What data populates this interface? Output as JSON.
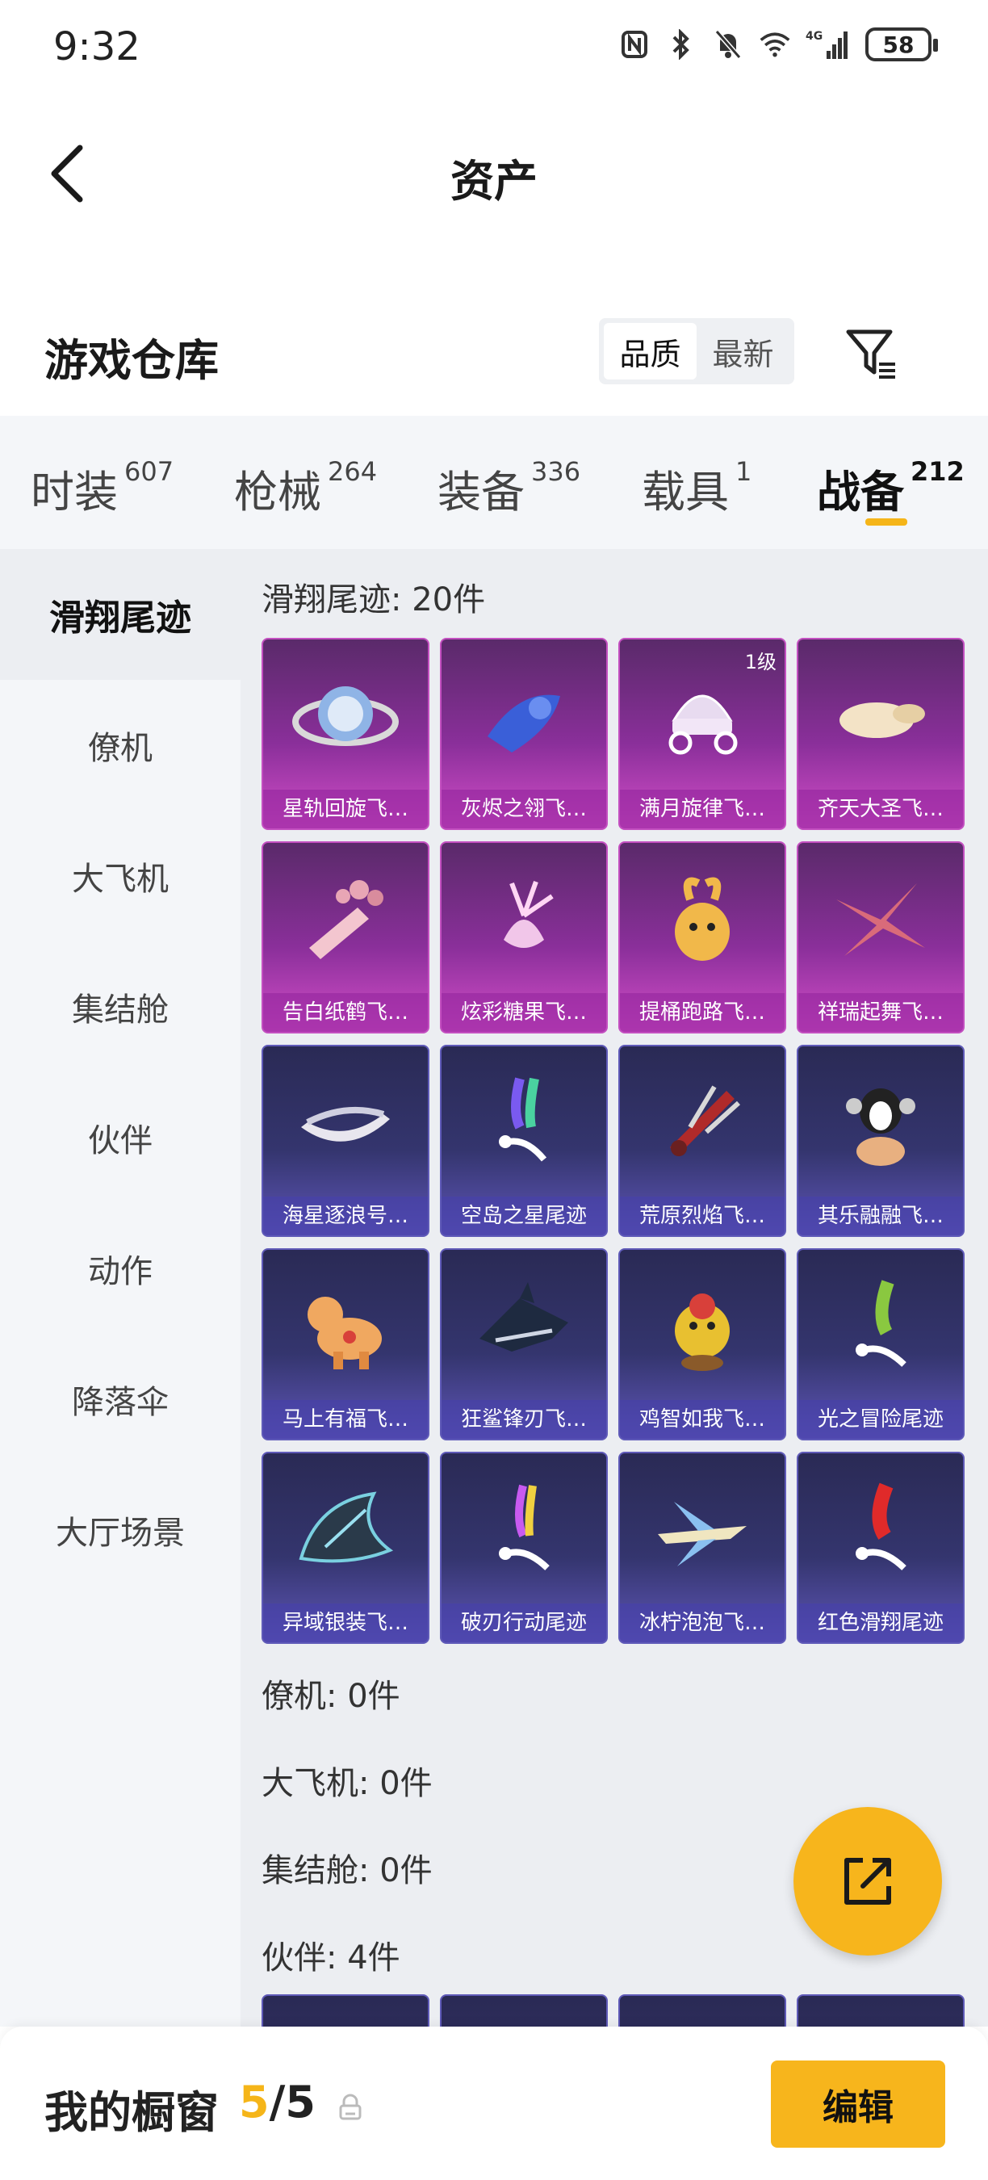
{
  "status_bar": {
    "time": "9:32",
    "network": "4G",
    "battery": "58"
  },
  "header": {
    "title": "资产"
  },
  "warehouse": {
    "title": "游戏仓库",
    "sort_options": [
      "品质",
      "最新"
    ],
    "sort_active": "品质"
  },
  "category_tabs": [
    {
      "label": "时装",
      "count": "607"
    },
    {
      "label": "枪械",
      "count": "264"
    },
    {
      "label": "装备",
      "count": "336"
    },
    {
      "label": "载具",
      "count": "1"
    },
    {
      "label": "战备",
      "count": "212",
      "active": true
    }
  ],
  "side_nav": [
    {
      "label": "滑翔尾迹",
      "active": true
    },
    {
      "label": "僚机"
    },
    {
      "label": "大飞机"
    },
    {
      "label": "集结舱"
    },
    {
      "label": "伙伴"
    },
    {
      "label": "动作"
    },
    {
      "label": "降落伞"
    },
    {
      "label": "大厅场景"
    }
  ],
  "sections": {
    "glide_trail": "滑翔尾迹: 20件",
    "wingman": "僚机: 0件",
    "big_plane": "大飞机: 0件",
    "assembly_pod": "集结舱: 0件",
    "partner": "伙伴: 4件"
  },
  "items": [
    {
      "name": "星轨回旋飞…",
      "rarity": "purple"
    },
    {
      "name": "灰烬之翎飞…",
      "rarity": "purple"
    },
    {
      "name": "满月旋律飞…",
      "rarity": "purple",
      "level": "1级"
    },
    {
      "name": "齐天大圣飞…",
      "rarity": "purple"
    },
    {
      "name": "告白纸鹤飞…",
      "rarity": "purple"
    },
    {
      "name": "炫彩糖果飞…",
      "rarity": "purple"
    },
    {
      "name": "提桶跑路飞…",
      "rarity": "purple"
    },
    {
      "name": "祥瑞起舞飞…",
      "rarity": "purple"
    },
    {
      "name": "海星逐浪号…",
      "rarity": "blue"
    },
    {
      "name": "空岛之星尾迹",
      "rarity": "blue"
    },
    {
      "name": "荒原烈焰飞…",
      "rarity": "blue"
    },
    {
      "name": "其乐融融飞…",
      "rarity": "blue"
    },
    {
      "name": "马上有福飞…",
      "rarity": "blue"
    },
    {
      "name": "狂鲨锋刃飞…",
      "rarity": "blue"
    },
    {
      "name": "鸡智如我飞…",
      "rarity": "blue"
    },
    {
      "name": "光之冒险尾迹",
      "rarity": "blue"
    },
    {
      "name": "异域银装飞…",
      "rarity": "blue"
    },
    {
      "name": "破刃行动尾迹",
      "rarity": "blue"
    },
    {
      "name": "冰柠泡泡飞…",
      "rarity": "blue"
    },
    {
      "name": "红色滑翔尾迹",
      "rarity": "blue"
    }
  ],
  "bottom": {
    "showcase_label": "我的橱窗",
    "showcase_current": "5",
    "showcase_sep": "/",
    "showcase_max": "5",
    "edit_label": "编辑"
  },
  "colors": {
    "accent": "#f7b51c",
    "purple_rarity": "#c34fc0",
    "blue_rarity": "#5f5ab8"
  }
}
